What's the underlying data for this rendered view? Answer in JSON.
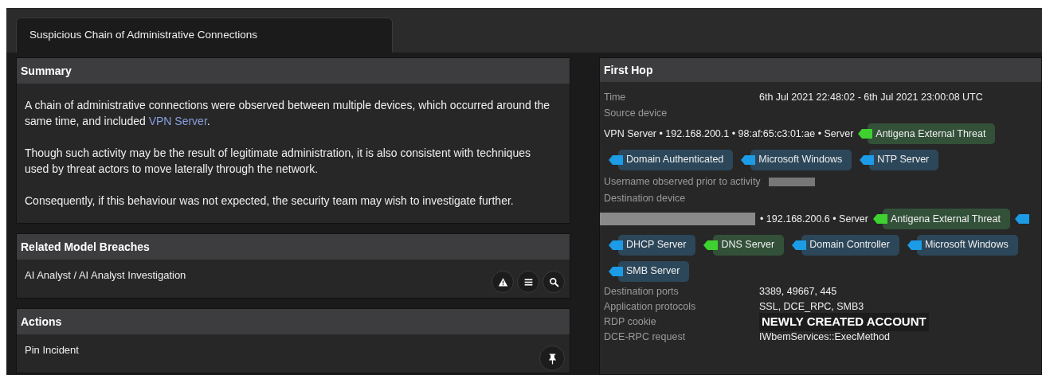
{
  "tabs": [
    {
      "label": "Suspicious Chain of Administrative Connections",
      "selected": true
    }
  ],
  "summary": {
    "title": "Summary",
    "paragraphs": [
      {
        "parts": [
          {
            "kind": "text",
            "text": "A chain of administrative connections were observed between multiple devices, which occurred around the same time, and included "
          },
          {
            "kind": "link",
            "text": "VPN Server"
          },
          {
            "kind": "text",
            "text": "."
          }
        ]
      },
      {
        "parts": [
          {
            "kind": "text",
            "text": "Though such activity may be the result of legitimate administration, it is also consistent with techniques used by threat actors to move laterally through the network."
          }
        ]
      },
      {
        "parts": [
          {
            "kind": "text",
            "text": "Consequently, if this behaviour was not expected, the security team may wish to investigate further."
          }
        ]
      }
    ]
  },
  "related_model_breaches": {
    "title": "Related Model Breaches",
    "items": [
      {
        "label": "AI Analyst / AI Analyst Investigation",
        "buttons": [
          {
            "kind": "warning"
          },
          {
            "kind": "list"
          },
          {
            "kind": "search"
          }
        ]
      }
    ]
  },
  "actions": {
    "title": "Actions",
    "items": [
      {
        "label": "Pin Incident",
        "buttons": [
          {
            "kind": "pin"
          }
        ]
      }
    ]
  },
  "first_hop": {
    "title": "First Hop",
    "rows": [
      {
        "kind": "pair",
        "label": "Time",
        "value": "6th Jul 2021 22:48:02 - 6th Jul 2021 23:00:08 UTC"
      },
      {
        "kind": "heading",
        "label": "Source device"
      },
      {
        "kind": "device",
        "redacted": false,
        "text": "VPN Server • 192.168.200.1 • 98:af:65:c3:01:ae • Server",
        "tags": [
          {
            "label": "Antigena External Threat",
            "color": "#3fd12f"
          }
        ]
      },
      {
        "kind": "tags",
        "tags": [
          {
            "label": "Domain Authenticated",
            "color": "#1c9be6"
          },
          {
            "label": "Microsoft Windows",
            "color": "#1c9be6"
          },
          {
            "label": "NTP Server",
            "color": "#1c9be6"
          }
        ]
      },
      {
        "kind": "redacted",
        "label": "Username observed prior to activity"
      },
      {
        "kind": "heading",
        "label": "Destination device"
      },
      {
        "kind": "device",
        "redacted": true,
        "text": "• 192.168.200.6 • Server",
        "tags": [
          {
            "label": "Antigena External Threat",
            "color": "#3fd12f"
          },
          {
            "color": "#1c9be6"
          }
        ]
      },
      {
        "kind": "tags",
        "tags": [
          {
            "label": "DHCP Server",
            "color": "#1c9be6"
          },
          {
            "label": "DNS Server",
            "color": "#3fd12f"
          },
          {
            "label": "Domain Controller",
            "color": "#1c9be6"
          },
          {
            "label": "Microsoft Windows",
            "color": "#1c9be6"
          }
        ]
      },
      {
        "kind": "tags",
        "tags": [
          {
            "label": "SMB Server",
            "color": "#1c9be6"
          }
        ]
      },
      {
        "kind": "pair",
        "label": "Destination ports",
        "value": "3389, 49667, 445"
      },
      {
        "kind": "pair",
        "label": "Application protocols",
        "value": "SSL, DCE_RPC, SMB3"
      },
      {
        "kind": "highlight",
        "label": "RDP cookie",
        "value": "NEWLY CREATED ACCOUNT"
      },
      {
        "kind": "pair",
        "label": "DCE-RPC request",
        "value": "IWbemServices::ExecMethod"
      }
    ]
  }
}
